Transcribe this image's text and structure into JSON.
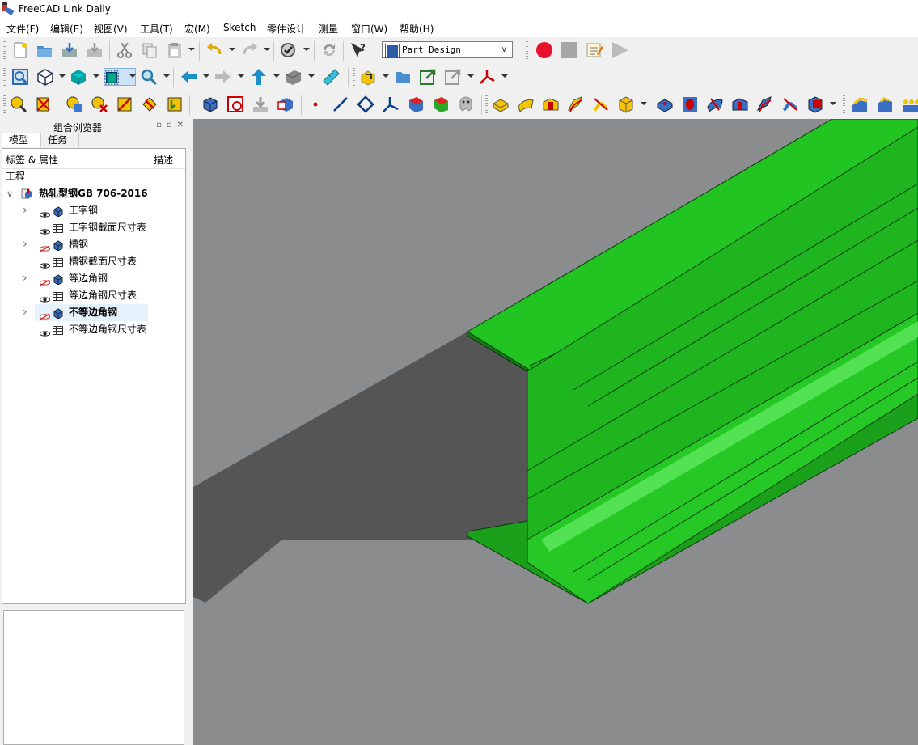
{
  "app": {
    "title": "FreeCAD Link Daily"
  },
  "menu": [
    "文件(F)",
    "编辑(E)",
    "视图(V)",
    "工具(T)",
    "宏(M)",
    "Sketch",
    "零件设计",
    "测量",
    "窗口(W)",
    "帮助(H)"
  ],
  "workbench": {
    "selected": "Part Design"
  },
  "panel": {
    "title": "组合浏览器",
    "tabs": [
      "模型",
      "任务"
    ],
    "columns": {
      "label": "标签 & 属性",
      "desc": "描述"
    },
    "section": "工程",
    "document": "热轧型钢GB 706-2016",
    "items": [
      {
        "label": "工字钢",
        "expandable": true,
        "visible": true,
        "icon": "body-icon"
      },
      {
        "label": "工字钢截面尺寸表",
        "expandable": false,
        "visible": true,
        "icon": "spreadsheet-icon"
      },
      {
        "label": "槽钢",
        "expandable": true,
        "visible": false,
        "icon": "body-icon"
      },
      {
        "label": "槽钢截面尺寸表",
        "expandable": false,
        "visible": true,
        "icon": "spreadsheet-icon"
      },
      {
        "label": "等边角钢",
        "expandable": true,
        "visible": false,
        "icon": "body-icon"
      },
      {
        "label": "等边角钢尺寸表",
        "expandable": false,
        "visible": true,
        "icon": "spreadsheet-icon"
      },
      {
        "label": "不等边角钢",
        "expandable": true,
        "visible": false,
        "icon": "body-icon",
        "selected": true
      },
      {
        "label": "不等边角钢尺寸表",
        "expandable": false,
        "visible": true,
        "icon": "spreadsheet-icon"
      }
    ]
  },
  "viewport": {
    "model_color": "#22b822",
    "background": "#8a8c8d"
  }
}
